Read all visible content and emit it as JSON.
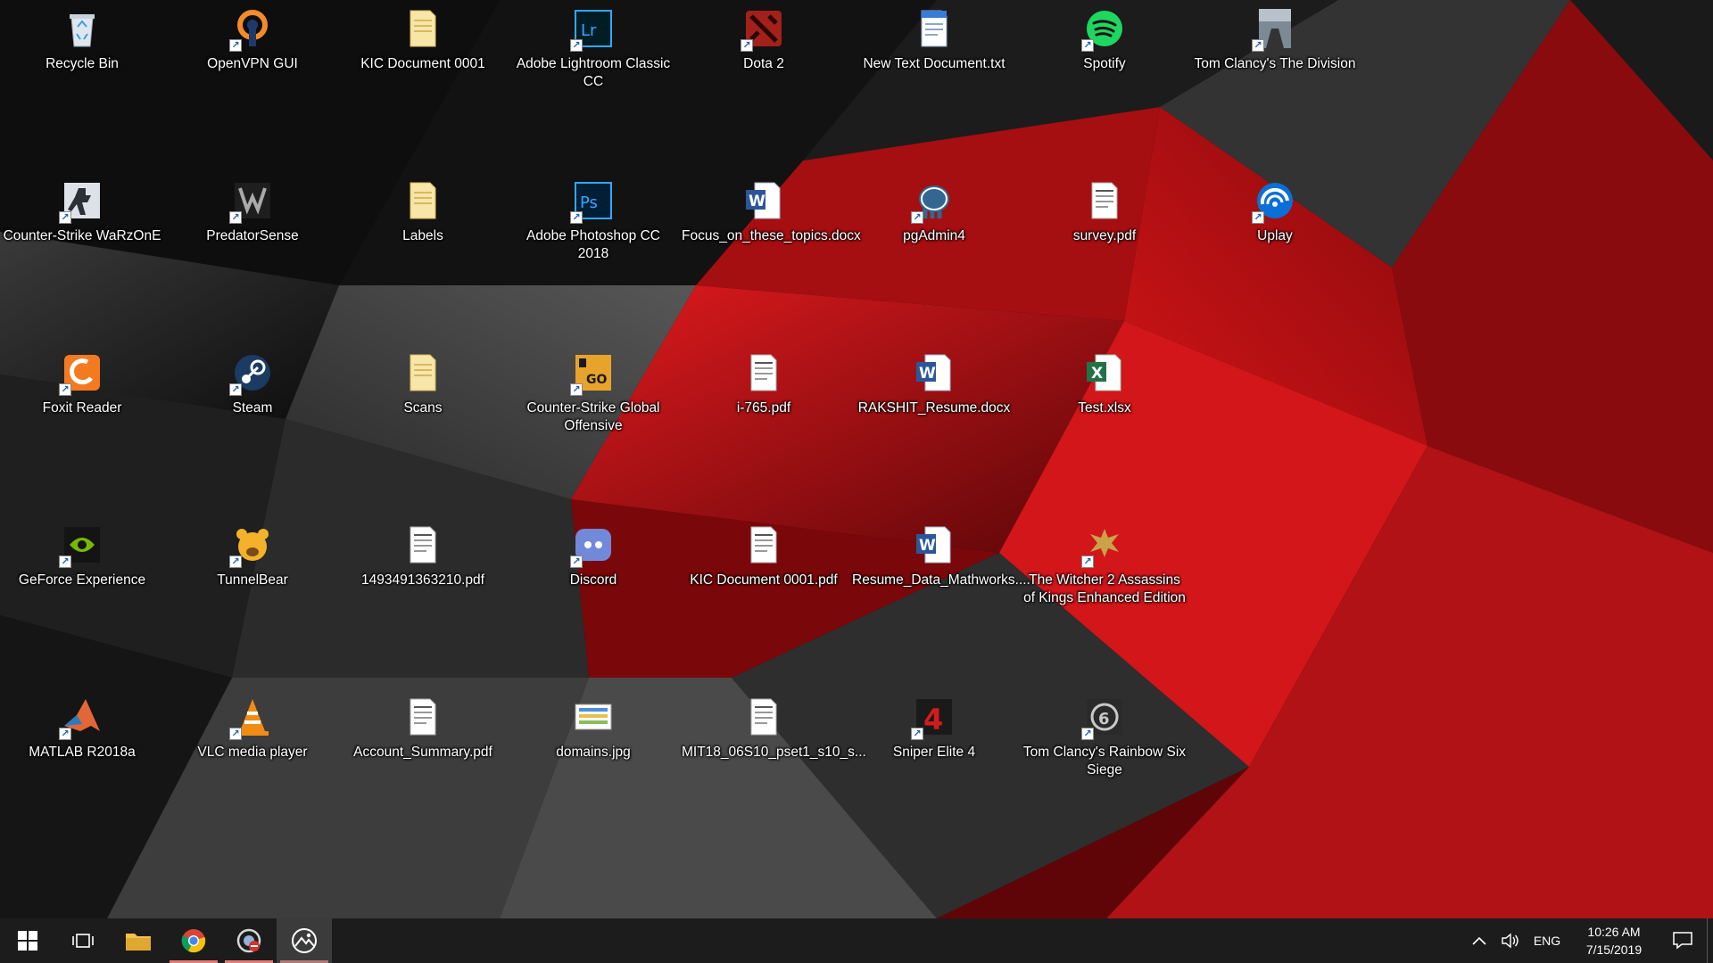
{
  "desktop": {
    "icons": [
      {
        "label": "Recycle Bin",
        "icon": "recycle-bin-icon",
        "shortcut": false
      },
      {
        "label": "OpenVPN GUI",
        "icon": "openvpn-icon",
        "shortcut": true
      },
      {
        "label": "KIC Document 0001",
        "icon": "folder-icon",
        "shortcut": false
      },
      {
        "label": "Adobe Lightroom Classic CC",
        "icon": "lightroom-icon",
        "shortcut": true
      },
      {
        "label": "Dota 2",
        "icon": "dota2-icon",
        "shortcut": true
      },
      {
        "label": "New Text Document.txt",
        "icon": "text-file-icon",
        "shortcut": false
      },
      {
        "label": "Spotify",
        "icon": "spotify-icon",
        "shortcut": true
      },
      {
        "label": "Tom Clancy's The Division",
        "icon": "division-icon",
        "shortcut": true
      },
      {
        "label": "Counter-Strike WaRzOnE",
        "icon": "counter-strike-icon",
        "shortcut": true
      },
      {
        "label": "PredatorSense",
        "icon": "predatorsense-icon",
        "shortcut": true
      },
      {
        "label": "Labels",
        "icon": "folder-icon",
        "shortcut": false
      },
      {
        "label": "Adobe Photoshop CC 2018",
        "icon": "photoshop-icon",
        "shortcut": true
      },
      {
        "label": "Focus_on_these_topics.docx",
        "icon": "word-doc-icon",
        "shortcut": false
      },
      {
        "label": "pgAdmin4",
        "icon": "pgadmin-elephant-icon",
        "shortcut": true
      },
      {
        "label": "survey.pdf",
        "icon": "pdf-file-icon",
        "shortcut": false
      },
      {
        "label": "Uplay",
        "icon": "uplay-icon",
        "shortcut": true
      },
      {
        "label": "Foxit Reader",
        "icon": "foxit-reader-icon",
        "shortcut": true
      },
      {
        "label": "Steam",
        "icon": "steam-icon",
        "shortcut": true
      },
      {
        "label": "Scans",
        "icon": "folder-icon",
        "shortcut": false
      },
      {
        "label": "Counter-Strike Global Offensive",
        "icon": "csgo-icon",
        "shortcut": true
      },
      {
        "label": "i-765.pdf",
        "icon": "pdf-file-icon",
        "shortcut": false
      },
      {
        "label": "RAKSHIT_Resume.docx",
        "icon": "word-doc-icon",
        "shortcut": false
      },
      {
        "label": "Test.xlsx",
        "icon": "excel-file-icon",
        "shortcut": false
      },
      {
        "label": "GeForce Experience",
        "icon": "geforce-icon",
        "shortcut": true
      },
      {
        "label": "TunnelBear",
        "icon": "tunnelbear-icon",
        "shortcut": true
      },
      {
        "label": "1493491363210.pdf",
        "icon": "pdf-file-icon",
        "shortcut": false
      },
      {
        "label": "Discord",
        "icon": "discord-icon",
        "shortcut": true
      },
      {
        "label": "KIC Document 0001.pdf",
        "icon": "pdf-file-icon",
        "shortcut": false
      },
      {
        "label": "Resume_Data_Mathworks....",
        "icon": "word-doc-icon",
        "shortcut": false
      },
      {
        "label": "The Witcher 2 Assassins of Kings Enhanced Edition",
        "icon": "witcher-icon",
        "shortcut": true
      },
      {
        "label": "MATLAB R2018a",
        "icon": "matlab-icon",
        "shortcut": true
      },
      {
        "label": "VLC media player",
        "icon": "vlc-cone-icon",
        "shortcut": true
      },
      {
        "label": "Account_Summary.pdf",
        "icon": "pdf-file-icon",
        "shortcut": false
      },
      {
        "label": "domains.jpg",
        "icon": "image-file-icon",
        "shortcut": false
      },
      {
        "label": "MIT18_06S10_pset1_s10_s...",
        "icon": "pdf-file-icon",
        "shortcut": false
      },
      {
        "label": "Sniper Elite 4",
        "icon": "sniper-elite-icon",
        "shortcut": true
      },
      {
        "label": "Tom Clancy's Rainbow Six Siege",
        "icon": "rainbow-six-icon",
        "shortcut": true
      }
    ]
  },
  "taskbar": {
    "buttons": [
      {
        "name": "start-button",
        "icon": "windows-logo-icon"
      },
      {
        "name": "task-view-button",
        "icon": "task-view-icon"
      },
      {
        "name": "file-explorer-button",
        "icon": "folder-icon"
      },
      {
        "name": "chrome-button",
        "icon": "chrome-icon"
      },
      {
        "name": "vpn-app-button",
        "icon": "vpn-app-icon"
      },
      {
        "name": "photos-app-button",
        "icon": "photos-icon"
      }
    ],
    "tray": {
      "language": "ENG",
      "time": "10:26 AM",
      "date": "7/15/2019"
    }
  },
  "colors": {
    "wallpaper_red": "#c01418",
    "wallpaper_dark": "#0b0b0b",
    "taskbar_bg": "#1c1c1c"
  }
}
